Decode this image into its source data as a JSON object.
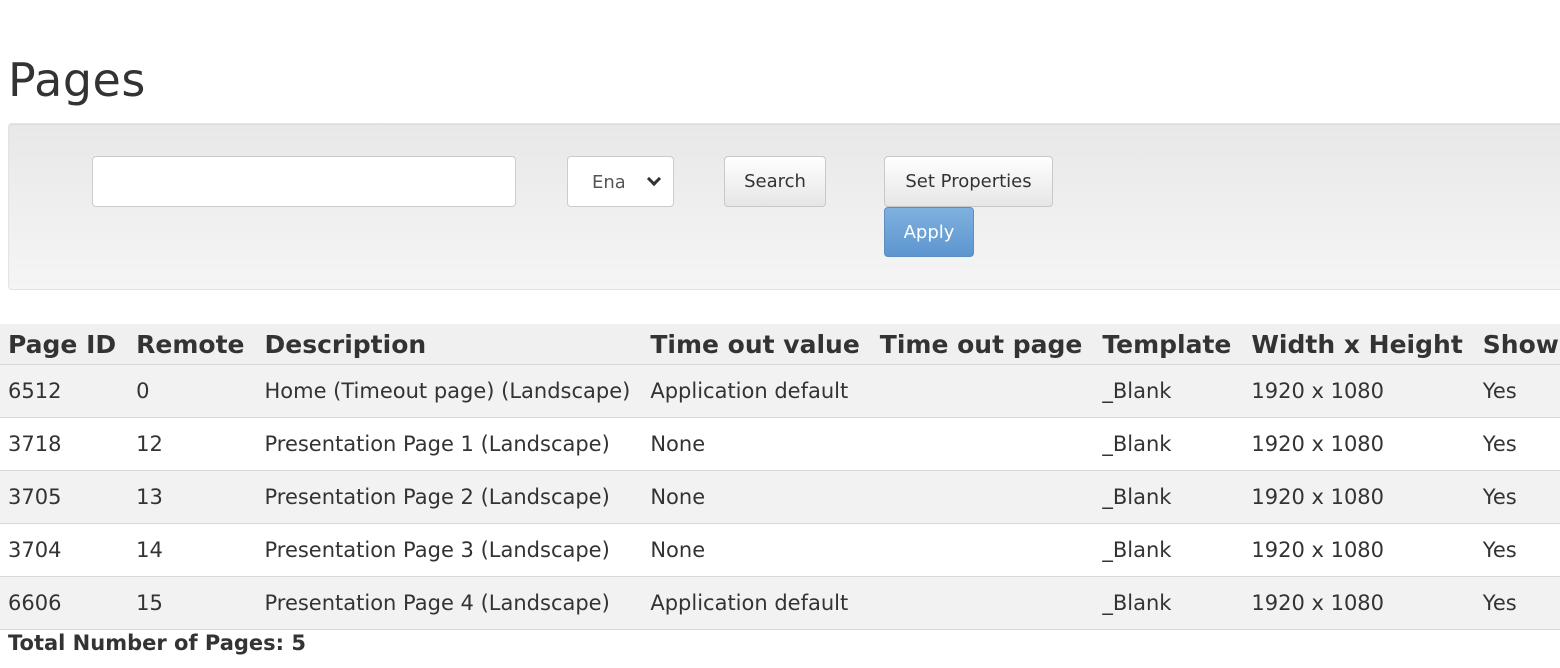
{
  "page": {
    "title": "Pages"
  },
  "filters": {
    "search_value": "",
    "status_select": {
      "selected": "Enabled"
    },
    "search_label": "Search",
    "set_properties_label": "Set Properties",
    "apply_label": "Apply"
  },
  "table": {
    "columns": [
      "Page ID",
      "Remote",
      "Description",
      "Time out value",
      "Time out page",
      "Template",
      "Width x Height",
      "Show"
    ],
    "rows": [
      {
        "page_id": "6512",
        "remote": "0",
        "description": "Home (Timeout page) (Landscape)",
        "timeout_value": "Application default",
        "timeout_page": "",
        "template": "_Blank",
        "size": "1920 x 1080",
        "show": "Yes"
      },
      {
        "page_id": "3718",
        "remote": "12",
        "description": "Presentation Page 1 (Landscape)",
        "timeout_value": "None",
        "timeout_page": "",
        "template": "_Blank",
        "size": "1920 x 1080",
        "show": "Yes"
      },
      {
        "page_id": "3705",
        "remote": "13",
        "description": "Presentation Page 2 (Landscape)",
        "timeout_value": "None",
        "timeout_page": "",
        "template": "_Blank",
        "size": "1920 x 1080",
        "show": "Yes"
      },
      {
        "page_id": "3704",
        "remote": "14",
        "description": "Presentation Page 3 (Landscape)",
        "timeout_value": "None",
        "timeout_page": "",
        "template": "_Blank",
        "size": "1920 x 1080",
        "show": "Yes"
      },
      {
        "page_id": "6606",
        "remote": "15",
        "description": "Presentation Page 4 (Landscape)",
        "timeout_value": "Application default",
        "timeout_page": "",
        "template": "_Blank",
        "size": "1920 x 1080",
        "show": "Yes"
      }
    ]
  },
  "footer": {
    "total_label": "Total Number of Pages: 5"
  },
  "colors": {
    "apply_button": "#6aa2d8",
    "panel_background": "#eeeeee",
    "row_stripe": "#f2f2f2"
  }
}
